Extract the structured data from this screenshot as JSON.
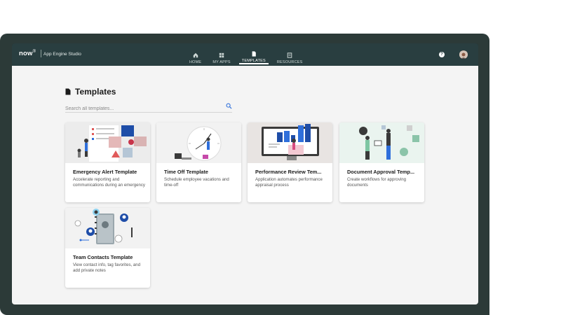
{
  "app": {
    "logo": "now",
    "logo_mark": "®",
    "name": "App Engine Studio"
  },
  "nav": {
    "items": [
      {
        "label": "HOME",
        "icon": "home-icon",
        "active": false
      },
      {
        "label": "MY APPS",
        "icon": "grid-icon",
        "active": false
      },
      {
        "label": "TEMPLATES",
        "icon": "document-icon",
        "active": true
      },
      {
        "label": "RESOURCES",
        "icon": "book-icon",
        "active": false
      }
    ],
    "help_label": "?"
  },
  "page": {
    "title": "Templates",
    "search_placeholder": "Search all templates..."
  },
  "templates": [
    {
      "title": "Emergency Alert Template",
      "description": "Accelerate reporting and communications during an emergency"
    },
    {
      "title": "Time Off Template",
      "description": "Schedule employee vacations and time-off"
    },
    {
      "title": "Performance Review Tem...",
      "description": "Application automates performance appraisal process"
    },
    {
      "title": "Document Approval Temp...",
      "description": "Create workflows for approving documents"
    },
    {
      "title": "Team Contacts Template",
      "description": "View contact info, tag favorites, and add private notes"
    }
  ],
  "colors": {
    "frame": "#2c3a38",
    "nav_bg": "#293e40",
    "page_bg": "#f4f4f4",
    "accent_blue": "#2f6fdb"
  }
}
